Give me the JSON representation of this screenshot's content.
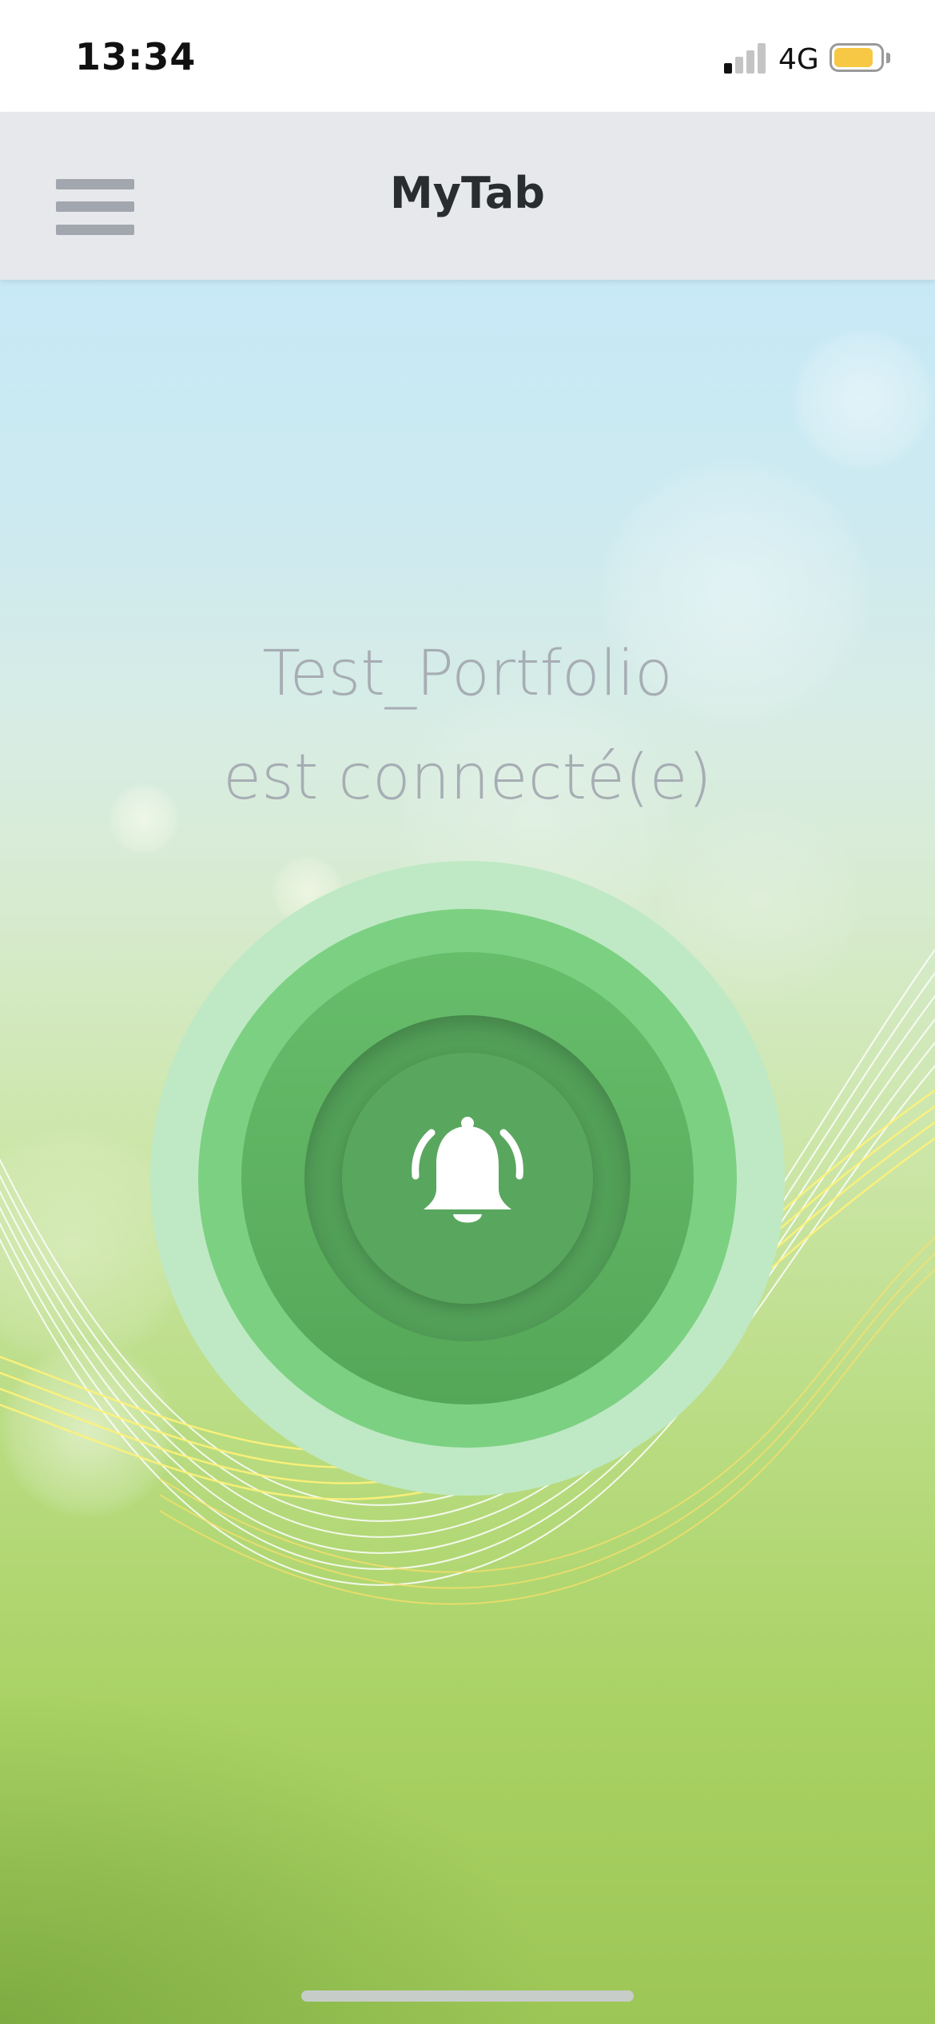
{
  "status_bar": {
    "time": "13:34",
    "network": "4G",
    "signal_bars_active": 1,
    "signal_bars_total": 4,
    "battery_level": 0.85,
    "battery_color": "#f7c844"
  },
  "nav": {
    "title": "MyTab",
    "menu_icon": "hamburger-menu-icon"
  },
  "connection": {
    "line1": "Test_Portfolio",
    "line2": "est connecté(e)"
  },
  "alarm_button": {
    "icon": "bell-icon",
    "colors": {
      "outer": "#bfe9c4",
      "ring": "#7cd082",
      "inner": "#529f58"
    }
  }
}
